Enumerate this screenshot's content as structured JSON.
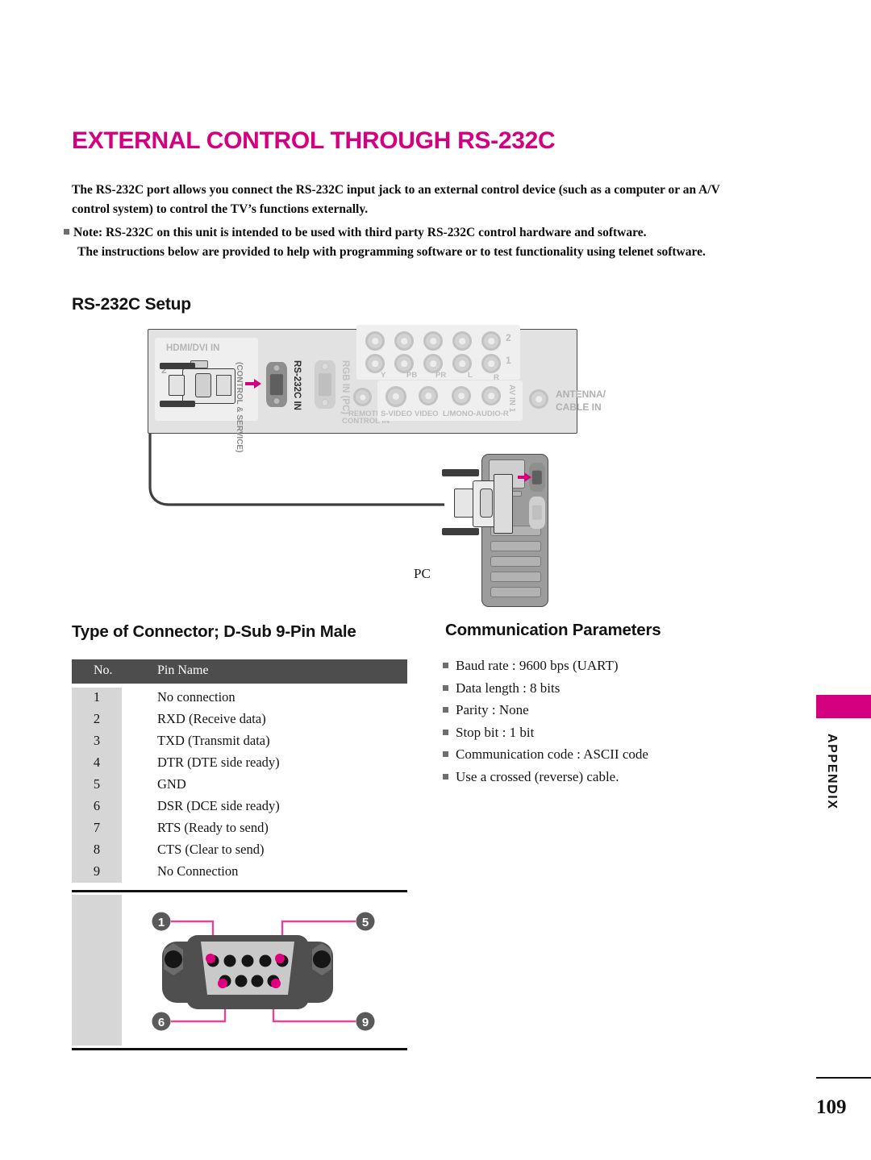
{
  "document": {
    "title": "EXTERNAL CONTROL THROUGH RS-232C",
    "intro_paragraph": "The RS-232C port allows you connect the RS-232C input jack to an external control device (such as a computer or an A/V control system) to control the TV’s functions externally.",
    "note_line": "Note: RS-232C on this unit is intended to be used with third party RS-232C control hardware and software.",
    "note_continuation": "The instructions below are provided to help with programming software or to test functionality using telenet software.",
    "page_number": "109",
    "side_tab": "APPENDIX",
    "accent_color": "#d5007f"
  },
  "setup_section": {
    "heading": "RS-232C Setup",
    "pc_label": "PC",
    "panel_labels": {
      "hdmi": "HDMI/DVI IN",
      "hdmi_number": "2",
      "control_service": "(CONTROL & SERVICE)",
      "rs232c": "RS-232C IN",
      "rgb": "RGB IN (PC)",
      "remote": "REMOTE\nCONTROL IN",
      "remote_line1": "REMOTE",
      "remote_line2": "CONTROL IN",
      "component_top_number": "2",
      "component_bottom_number": "1",
      "component_y": "Y",
      "component_pb": "PB",
      "component_pr": "PR",
      "component_l": "L",
      "component_r": "R",
      "svideo": "S-VIDEO",
      "video": "VIDEO",
      "audio": "L/MONO-AUDIO-R",
      "av_in_1": "AV IN 1",
      "antenna_line1": "ANTENNA/",
      "antenna_line2": "CABLE IN"
    }
  },
  "connector_section": {
    "heading": "Type of Connector; D-Sub 9-Pin Male",
    "columns": [
      "No.",
      "Pin Name"
    ],
    "rows": [
      {
        "no": "1",
        "name": "No connection"
      },
      {
        "no": "2",
        "name": "RXD (Receive data)"
      },
      {
        "no": "3",
        "name": "TXD (Transmit data)"
      },
      {
        "no": "4",
        "name": "DTR (DTE side ready)"
      },
      {
        "no": "5",
        "name": "GND"
      },
      {
        "no": "6",
        "name": "DSR (DCE side ready)"
      },
      {
        "no": "7",
        "name": "RTS (Ready to send)"
      },
      {
        "no": "8",
        "name": "CTS (Clear to send)"
      },
      {
        "no": "9",
        "name": "No Connection"
      }
    ],
    "pinout_callouts": [
      "1",
      "5",
      "6",
      "9"
    ]
  },
  "communication_section": {
    "heading": "Communication Parameters",
    "items": [
      "Baud rate : 9600 bps (UART)",
      "Data length : 8 bits",
      "Parity : None",
      "Stop bit : 1 bit",
      "Communication code : ASCII code",
      "Use a crossed (reverse) cable."
    ]
  }
}
